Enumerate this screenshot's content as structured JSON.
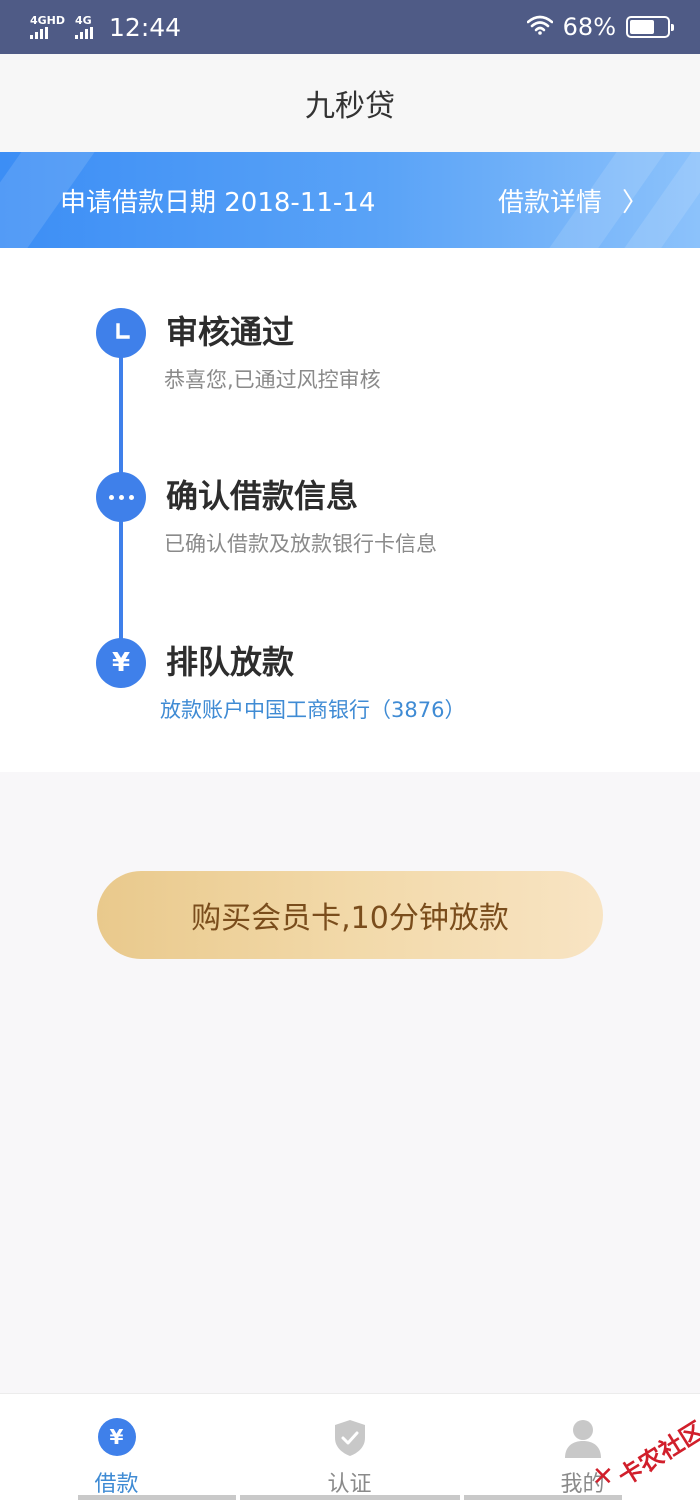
{
  "status_bar": {
    "net1": "4GHD",
    "net2": "4G",
    "time": "12:44",
    "battery_percent": "68%",
    "battery_level": 0.68
  },
  "header": {
    "title": "九秒贷"
  },
  "banner": {
    "date_text": "申请借款日期 2018-11-14",
    "link_label": "借款详情",
    "link_chevron": "〉"
  },
  "steps": [
    {
      "title": "审核通过",
      "subtitle": "恭喜您,已通过风控审核",
      "icon": "clock-icon"
    },
    {
      "title": "确认借款信息",
      "subtitle": "已确认借款及放款银行卡信息",
      "icon": "more-dots-icon"
    },
    {
      "title": "排队放款",
      "subtitle": "放款账户中国工商银行（3876）",
      "icon": "yen-icon"
    }
  ],
  "cta": {
    "label": "购买会员卡,10分钟放款"
  },
  "tabs": [
    {
      "label": "借款",
      "icon": "yen-icon",
      "active": true
    },
    {
      "label": "认证",
      "icon": "shield-check-icon",
      "active": false
    },
    {
      "label": "我的",
      "icon": "user-icon",
      "active": false
    }
  ],
  "watermark": {
    "text": "卡农社区"
  },
  "colors": {
    "status_bar_bg": "#4f5b86",
    "primary_blue": "#3f80ea",
    "link_blue": "#3f8bd4",
    "cta_gold_start": "#e9c98c",
    "cta_gold_end": "#f8e4c3",
    "cta_text": "#7a4d1c"
  }
}
